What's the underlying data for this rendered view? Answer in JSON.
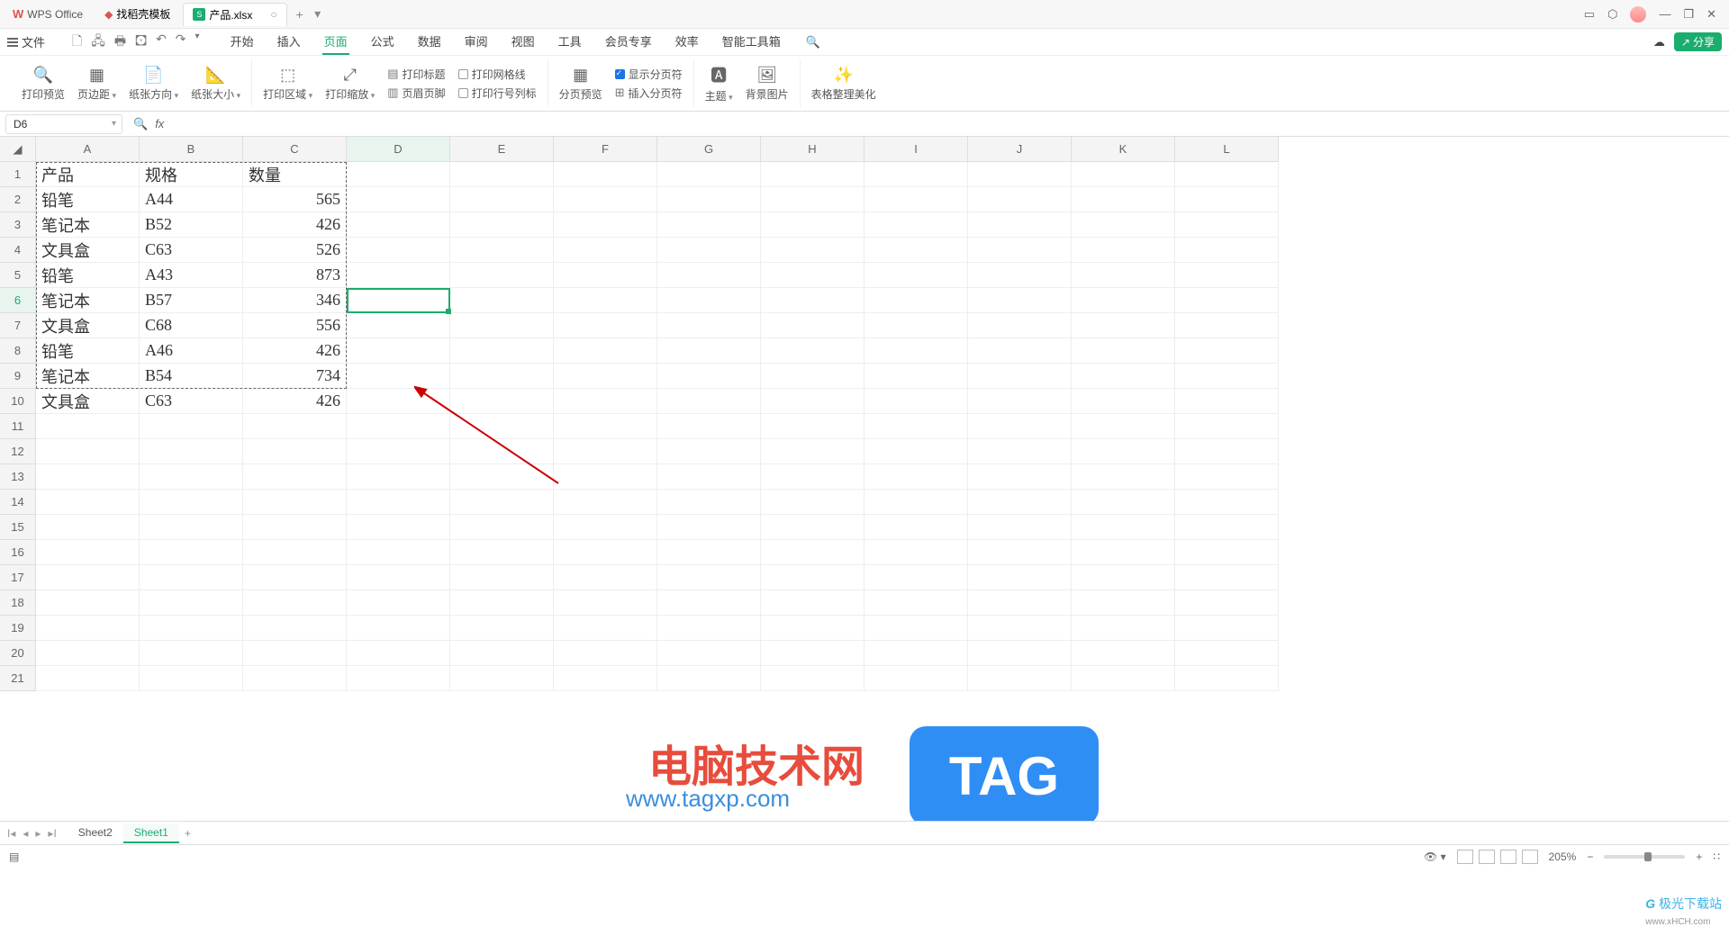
{
  "titlebar": {
    "app_name": "WPS Office",
    "template_tab": "找稻壳模板",
    "activeFile": "产品.xlsx",
    "winIcons": [
      "▭",
      "⬡",
      "avatar",
      "—",
      "❐",
      "✕"
    ]
  },
  "menubar": {
    "file": "文件",
    "qat": [
      "🗋",
      "🖧",
      "🖶",
      "🖸",
      "↶",
      "↷"
    ],
    "tabs": [
      "开始",
      "插入",
      "页面",
      "公式",
      "数据",
      "审阅",
      "视图",
      "工具",
      "会员专享",
      "效率",
      "智能工具箱"
    ],
    "activeTab": "页面",
    "cloud_icon": "☁",
    "share": "分享"
  },
  "ribbon": {
    "g1": {
      "printPreview": "打印预览",
      "pageMargin": "页边距",
      "paperDir": "纸张方向",
      "paperSize": "纸张大小"
    },
    "g2": {
      "printArea": "打印区域",
      "printScale": "打印缩放",
      "printTitle": "打印标题",
      "headerFooter": "页眉页脚",
      "printGrid": "打印网格线",
      "printRowCol": "打印行号列标"
    },
    "g3": {
      "splitPreview": "分页预览",
      "insertBreak": "插入分页符",
      "showBreak": "显示分页符"
    },
    "g4": {
      "theme": "主题",
      "bgImage": "背景图片"
    },
    "g5": {
      "tableBeauty": "表格整理美化"
    }
  },
  "namebox": {
    "cell": "D6"
  },
  "columns": [
    "A",
    "B",
    "C",
    "D",
    "E",
    "F",
    "G",
    "H",
    "I",
    "J",
    "K",
    "L"
  ],
  "rowCount": 21,
  "activeRow": 6,
  "activeCol": "D",
  "headers": {
    "A": "产品",
    "B": "规格",
    "C": "数量"
  },
  "rows": [
    {
      "A": "铅笔",
      "B": "A44",
      "C": "565"
    },
    {
      "A": "笔记本",
      "B": "B52",
      "C": "426"
    },
    {
      "A": "文具盒",
      "B": "C63",
      "C": "526"
    },
    {
      "A": "铅笔",
      "B": "A43",
      "C": "873"
    },
    {
      "A": "笔记本",
      "B": "B57",
      "C": "346"
    },
    {
      "A": "文具盒",
      "B": "C68",
      "C": "556"
    },
    {
      "A": "铅笔",
      "B": "A46",
      "C": "426"
    },
    {
      "A": "笔记本",
      "B": "B54",
      "C": "734"
    },
    {
      "A": "文具盒",
      "B": "C63",
      "C": "426"
    }
  ],
  "sheets": {
    "list": [
      "Sheet2",
      "Sheet1"
    ],
    "active": "Sheet1"
  },
  "statusbar": {
    "zoom": "205%"
  },
  "watermark": {
    "cn": "电脑技术网",
    "url": "www.tagxp.com",
    "tag": "TAG",
    "dl": "极光下载站",
    "dlurl": "www.xHCH.com"
  }
}
